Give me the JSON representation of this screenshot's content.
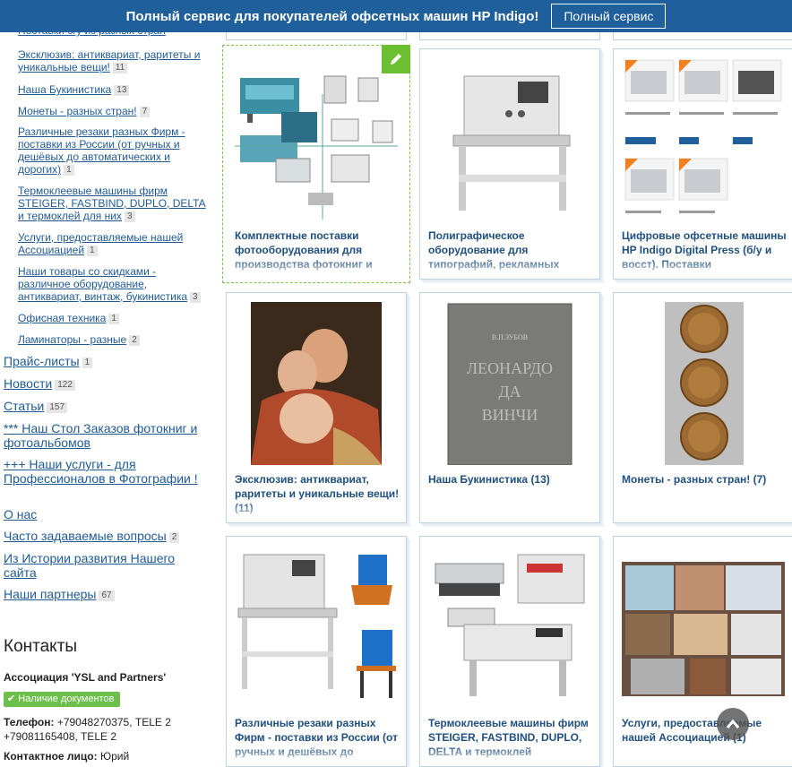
{
  "banner": {
    "text": "Полный сервис для покупателей офсетных машин HP Indigo!",
    "button": "Полный сервис"
  },
  "sidebar": {
    "sub_items": [
      {
        "label": "Эксклюзив: антиквариат, раритеты и уникальные вещи!",
        "count": "11"
      },
      {
        "label": "Наша Букинистика",
        "count": "13"
      },
      {
        "label": "Монеты - разных стран!",
        "count": "7"
      },
      {
        "label": "Различные резаки разных Фирм - поставки из России (от ручных и дешёвых до автоматических и дорогих)",
        "count": "1"
      },
      {
        "label": "Термоклеевые машины фирм STEIGER, FASTBIND, DUPLO, DELTA и термоклей для них",
        "count": "3"
      },
      {
        "label": "Услуги, предоставляемые нашей Ассоциацией",
        "count": "1"
      },
      {
        "label": "Наши товары со скидками - различное оборудование, антиквариат, винтаж, букинистика",
        "count": "3"
      },
      {
        "label": "Офисная техника",
        "count": "1"
      },
      {
        "label": "Ламинаторы - разные",
        "count": "2"
      }
    ],
    "top_items": [
      {
        "label": "Прайс-листы",
        "count": "1"
      },
      {
        "label": "Новости",
        "count": "122"
      },
      {
        "label": "Статьи",
        "count": "157"
      },
      {
        "label": "*** Наш Стол Заказов фотокниг и фотоальбомов",
        "count": ""
      },
      {
        "label": "+++ Наши услуги - для Профессионалов в Фотографии !",
        "count": ""
      },
      {
        "label": "О нас",
        "count": ""
      },
      {
        "label": "Часто задаваемые вопросы",
        "count": "2"
      },
      {
        "label": "Из Истории развития Нашего сайта",
        "count": ""
      },
      {
        "label": "Наши партнеры",
        "count": "67"
      }
    ]
  },
  "contacts": {
    "title": "Контакты",
    "association": "Ассоциация 'YSL and Partners'",
    "docs_badge": "Наличие документов",
    "phone_label": "Телефон:",
    "phone_value": "+79048270375, TELE 2 +79081165408, TELE 2",
    "person_label": "Контактное лицо:",
    "person_value": "Юрий"
  },
  "cards": [
    {
      "title": "Комплектные поставки фотооборудования для производства фотокниг и"
    },
    {
      "title": "Полиграфическое оборудование для типографий, рекламных"
    },
    {
      "title": "Цифровые офсетные машины HP Indigo Digital Press (б/у и восст). Поставки"
    },
    {
      "title": "Эксклюзив: антиквариат, раритеты и уникальные вещи! (11)"
    },
    {
      "title": "Наша Букинистика (13)"
    },
    {
      "title": "Монеты - разных стран! (7)"
    },
    {
      "title": "Различные резаки разных Фирм - поставки из России (от ручных и дешёвых до"
    },
    {
      "title": "Термоклеевые машины фирм STEIGER, FASTBIND, DUPLO, DELTA и термоклей"
    },
    {
      "title": "Услуги, предоставляемые нашей Ассоциацией (1)"
    }
  ],
  "book_cover": {
    "author": "В.П.ЗУБОВ",
    "line1": "ЛЕОНАРДО",
    "line2": "ДА",
    "line3": "ВИНЧИ"
  },
  "colors": {
    "brand": "#1f5f9b",
    "link": "#1f5a96",
    "accent_green": "#6cbf4a"
  },
  "icons": [
    "pencil-icon",
    "check-icon",
    "chevron-up-icon"
  ]
}
